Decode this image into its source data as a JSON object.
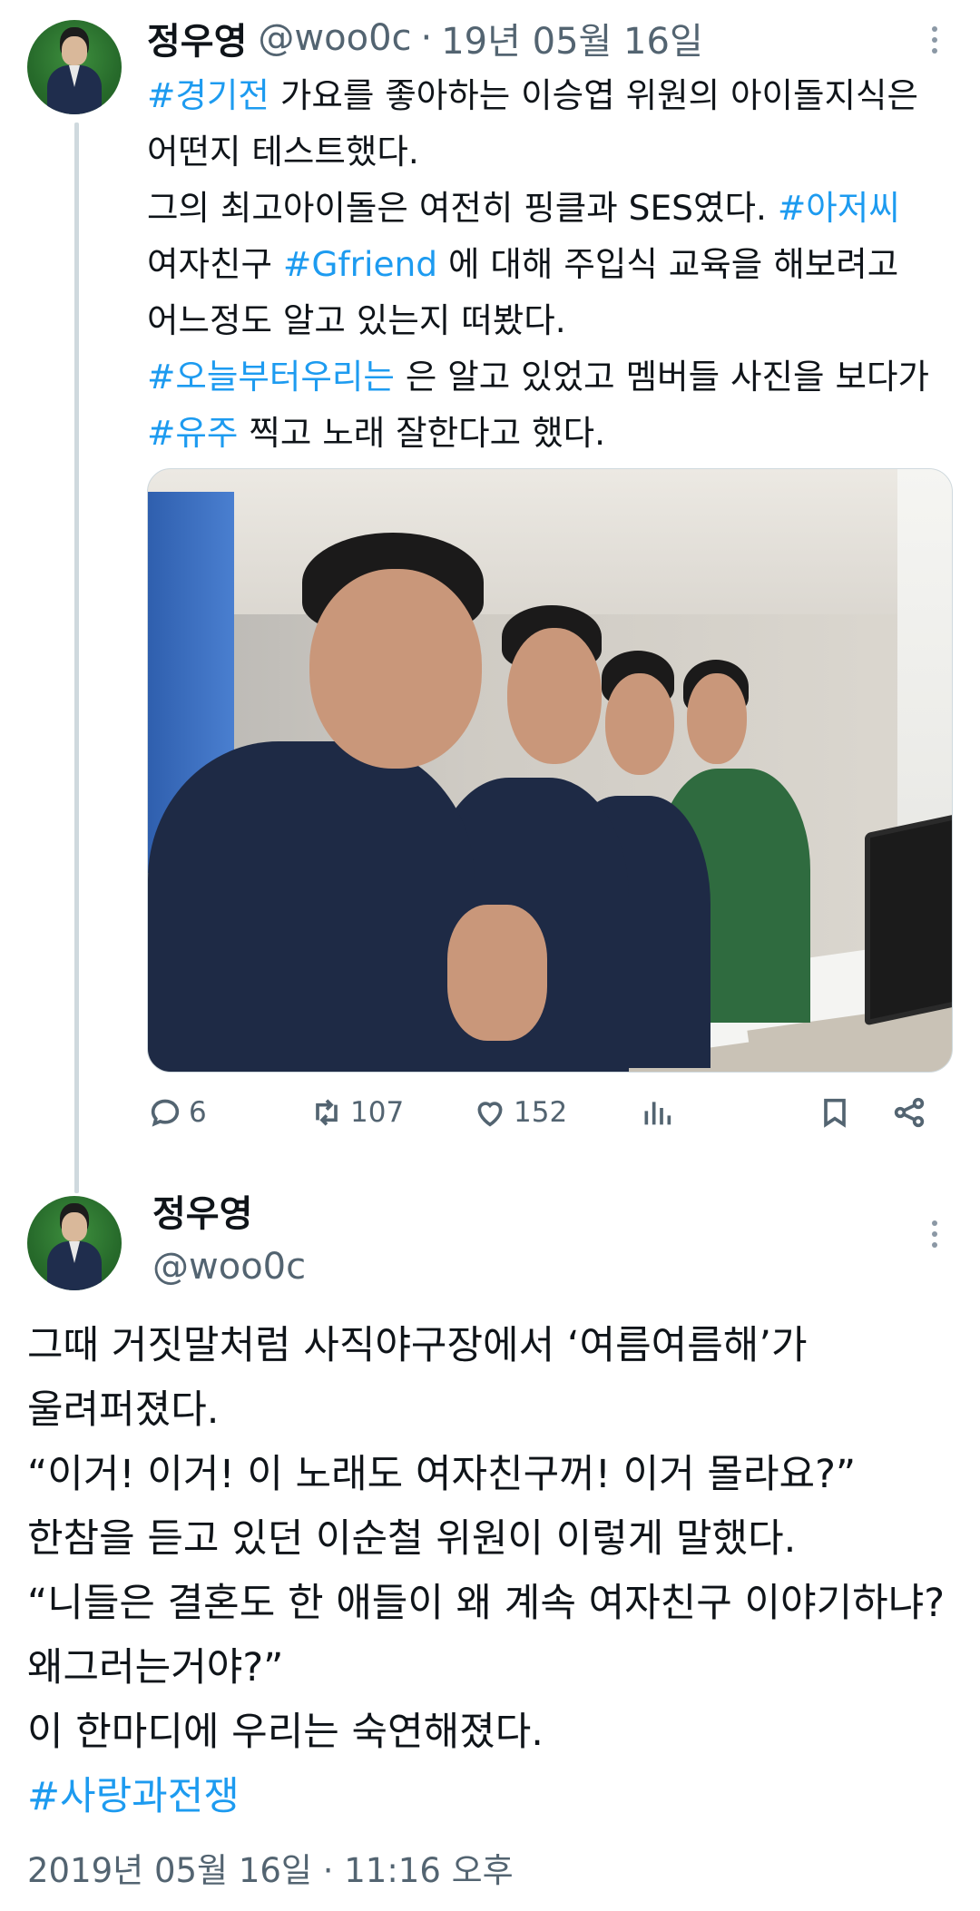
{
  "tweet1": {
    "author_name": "정우영",
    "author_handle": "@woo0c",
    "separator": "·",
    "date": "19년 05월 16일",
    "lines": [
      {
        "tag": "#경기전",
        "text": " 가요를 좋아하는 이승엽 위원의 아이돌지식은"
      },
      {
        "text": "어떤지 테스트했다."
      },
      {
        "text": "그의 최고아이돌은 여전히 핑클과 SES였다. ",
        "tag": "#아저씨"
      },
      {
        "text": "여자친구 ",
        "tag": "#Gfriend",
        "text2": " 에 대해 주입식 교육을 해보려고"
      },
      {
        "text": "어느정도 알고 있는지 떠봤다."
      },
      {
        "tag": "#오늘부터우리는",
        "text": " 은 알고 있었고 멤버들 사진을 보다가"
      },
      {
        "tag": "#유주",
        "text": " 찍고 노래 잘한다고 했다."
      }
    ],
    "actions": {
      "reply_count": "6",
      "retweet_count": "107",
      "like_count": "152"
    }
  },
  "tweet2": {
    "author_name": "정우영",
    "author_handle": "@woo0c",
    "lines": [
      "그때 거짓말처럼 사직야구장에서 ‘여름여름해’가",
      "울려퍼졌다.",
      "“이거! 이거! 이 노래도 여자친구꺼! 이거 몰라요?”",
      "한참을 듣고 있던 이순철 위원이 이렇게 말했다.",
      "“니들은 결혼도 한 애들이 왜 계속 여자친구 이야기하냐?",
      "왜그러는거야?”",
      "이 한마디에 우리는 숙연해졌다."
    ],
    "hashtag": "#사랑과전쟁",
    "timestamp": "2019년 05월 16일 · 11:16 오후"
  },
  "colors": {
    "link": "#1d9bf0",
    "secondary_text": "#536471",
    "thread_line": "#cfd9de"
  },
  "icons": [
    "reply-icon",
    "retweet-icon",
    "like-icon",
    "views-icon",
    "bookmark-icon",
    "share-icon",
    "more-icon"
  ]
}
